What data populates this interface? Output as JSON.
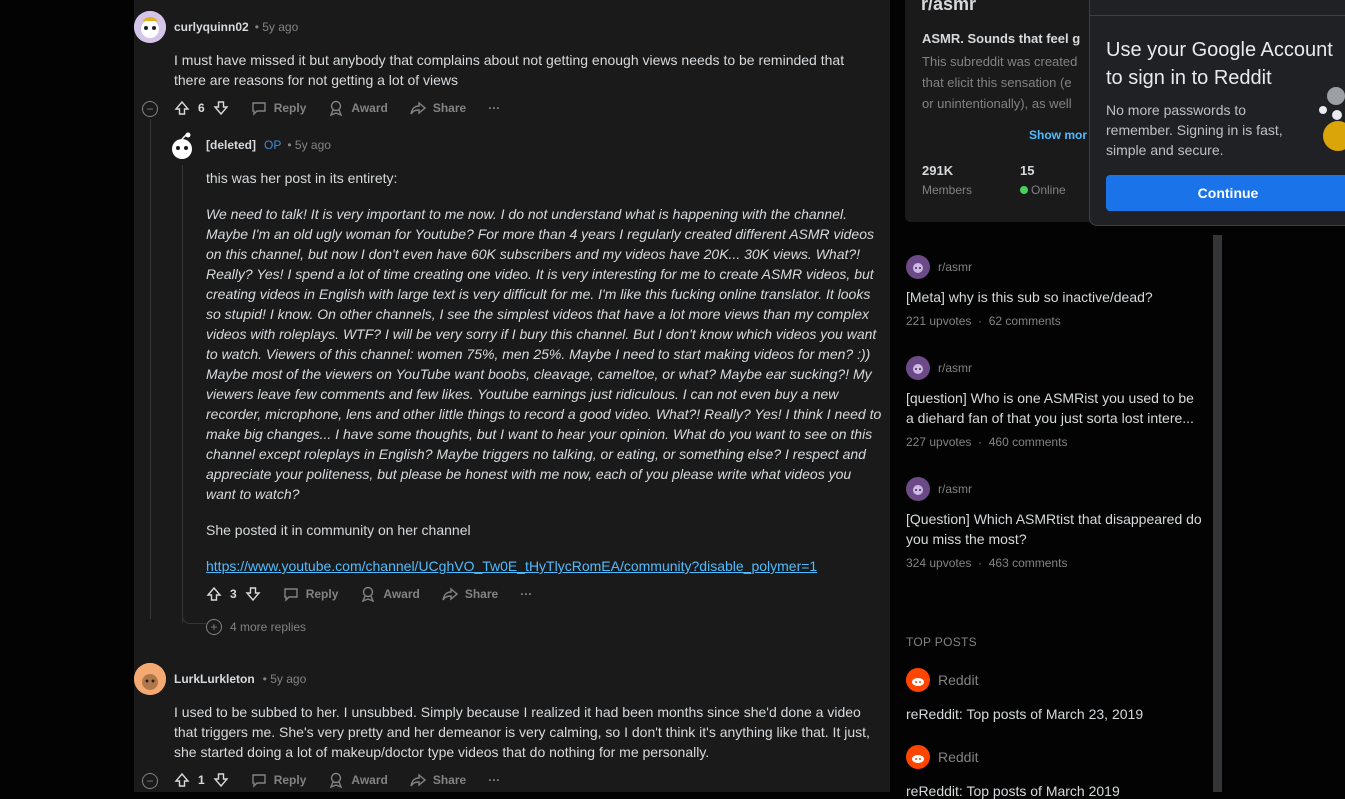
{
  "comments": [
    {
      "author": "curlyquinn02",
      "time": "• 5y ago",
      "text": "I must have missed it but anybody that complains about not getting enough views needs to be reminded that there are reasons for not getting a lot of views",
      "votes": "6",
      "reply": "Reply",
      "award": "Award",
      "share": "Share",
      "more": "···"
    },
    {
      "author": "[deleted]",
      "op": "OP",
      "time": "• 5y ago",
      "intro": "this was her post in its entirety:",
      "quote": "We need to talk! It is very important to me now. I do not understand what is happening with the channel. Maybe I'm an old ugly woman for Youtube? For more than 4 years I regularly created different ASMR videos on this channel, but now I don't even have 60K subscribers and my videos have 20K... 30K views. What?! Really? Yes! I spend a lot of time creating one video. It is very interesting for me to create ASMR videos, but creating videos in English with large text is very difficult for me. I'm like this fucking online translator. It looks so stupid! I know. On other channels, I see the simplest videos that have a lot more views than my complex videos with roleplays. WTF? I will be very sorry if I bury this channel. But I don't know which videos you want to watch. Viewers of this channel: women 75%, men 25%. Maybe I need to start making videos for men? :)) Maybe most of the viewers on YouTube want boobs, cleavage, cameltoe, or what? Maybe ear sucking?! My viewers leave few comments and few likes. Youtube earnings just ridiculous. I can not even buy a new recorder, microphone, lens and other little things to record a good video. What?! Really? Yes! I think I need to make big changes... I have some thoughts, but I want to hear your opinion. What do you want to see on this channel except roleplays in English? Maybe triggers no talking, or eating, or something else? I respect and appreciate your politeness, but please be honest with me now, each of you please write what videos you want to watch?",
      "outro": "She posted it in community on her channel",
      "link": "https://www.youtube.com/channel/UCghVO_Tw0E_tHyTlycRomEA/community?disable_polymer=1",
      "votes": "3",
      "reply": "Reply",
      "award": "Award",
      "share": "Share",
      "more": "···",
      "more_replies": "4 more replies"
    },
    {
      "author": "LurkLurkleton",
      "time": "• 5y ago",
      "text": "I used to be subbed to her. I unsubbed. Simply because I realized it had been months since she'd done a video that triggers me. She's very pretty and her demeanor is very calming, so I don't think it's anything like that. It just, she started doing a lot of makeup/doctor type videos that do nothing for me personally.",
      "votes": "1",
      "reply": "Reply",
      "award": "Award",
      "share": "Share",
      "more": "···"
    }
  ],
  "subreddit": {
    "name": "r/asmr",
    "headline": "ASMR. Sounds that feel g",
    "desc1": "This subreddit was created",
    "desc2": "that elicit this sensation (e",
    "desc3": "or unintentionally), as well",
    "show_more": "Show mor",
    "members": "291K",
    "members_label": "Members",
    "online": "15",
    "online_label": "Online"
  },
  "related": [
    {
      "sub": "r/asmr",
      "title": "[Meta] why is this sub so inactive/dead?",
      "upvotes": "221 upvotes",
      "comments": "62 comments"
    },
    {
      "sub": "r/asmr",
      "title": "[question] Who is one ASMRist you used to be a diehard fan of that you just sorta lost intere...",
      "upvotes": "227 upvotes",
      "comments": "460 comments"
    },
    {
      "sub": "r/asmr",
      "title": "[Question] Which ASMRtist that disappeared do you miss the most?",
      "upvotes": "324 upvotes",
      "comments": "463 comments"
    }
  ],
  "top_posts": {
    "label": "TOP POSTS",
    "items": [
      {
        "sub": "Reddit",
        "title": "reReddit: Top posts of March 23, 2019"
      },
      {
        "sub": "Reddit",
        "title": "reReddit: Top posts of March 2019"
      }
    ]
  },
  "google_prompt": {
    "title": "Use your Google Account to sign in to Reddit",
    "desc": "No more passwords to remember. Signing in is fast, simple and secure.",
    "button": "Continue"
  },
  "colors": {
    "accent": "#1a73e8",
    "link": "#4fbcff",
    "online": "#46d160",
    "reddit": "#ff4500"
  }
}
